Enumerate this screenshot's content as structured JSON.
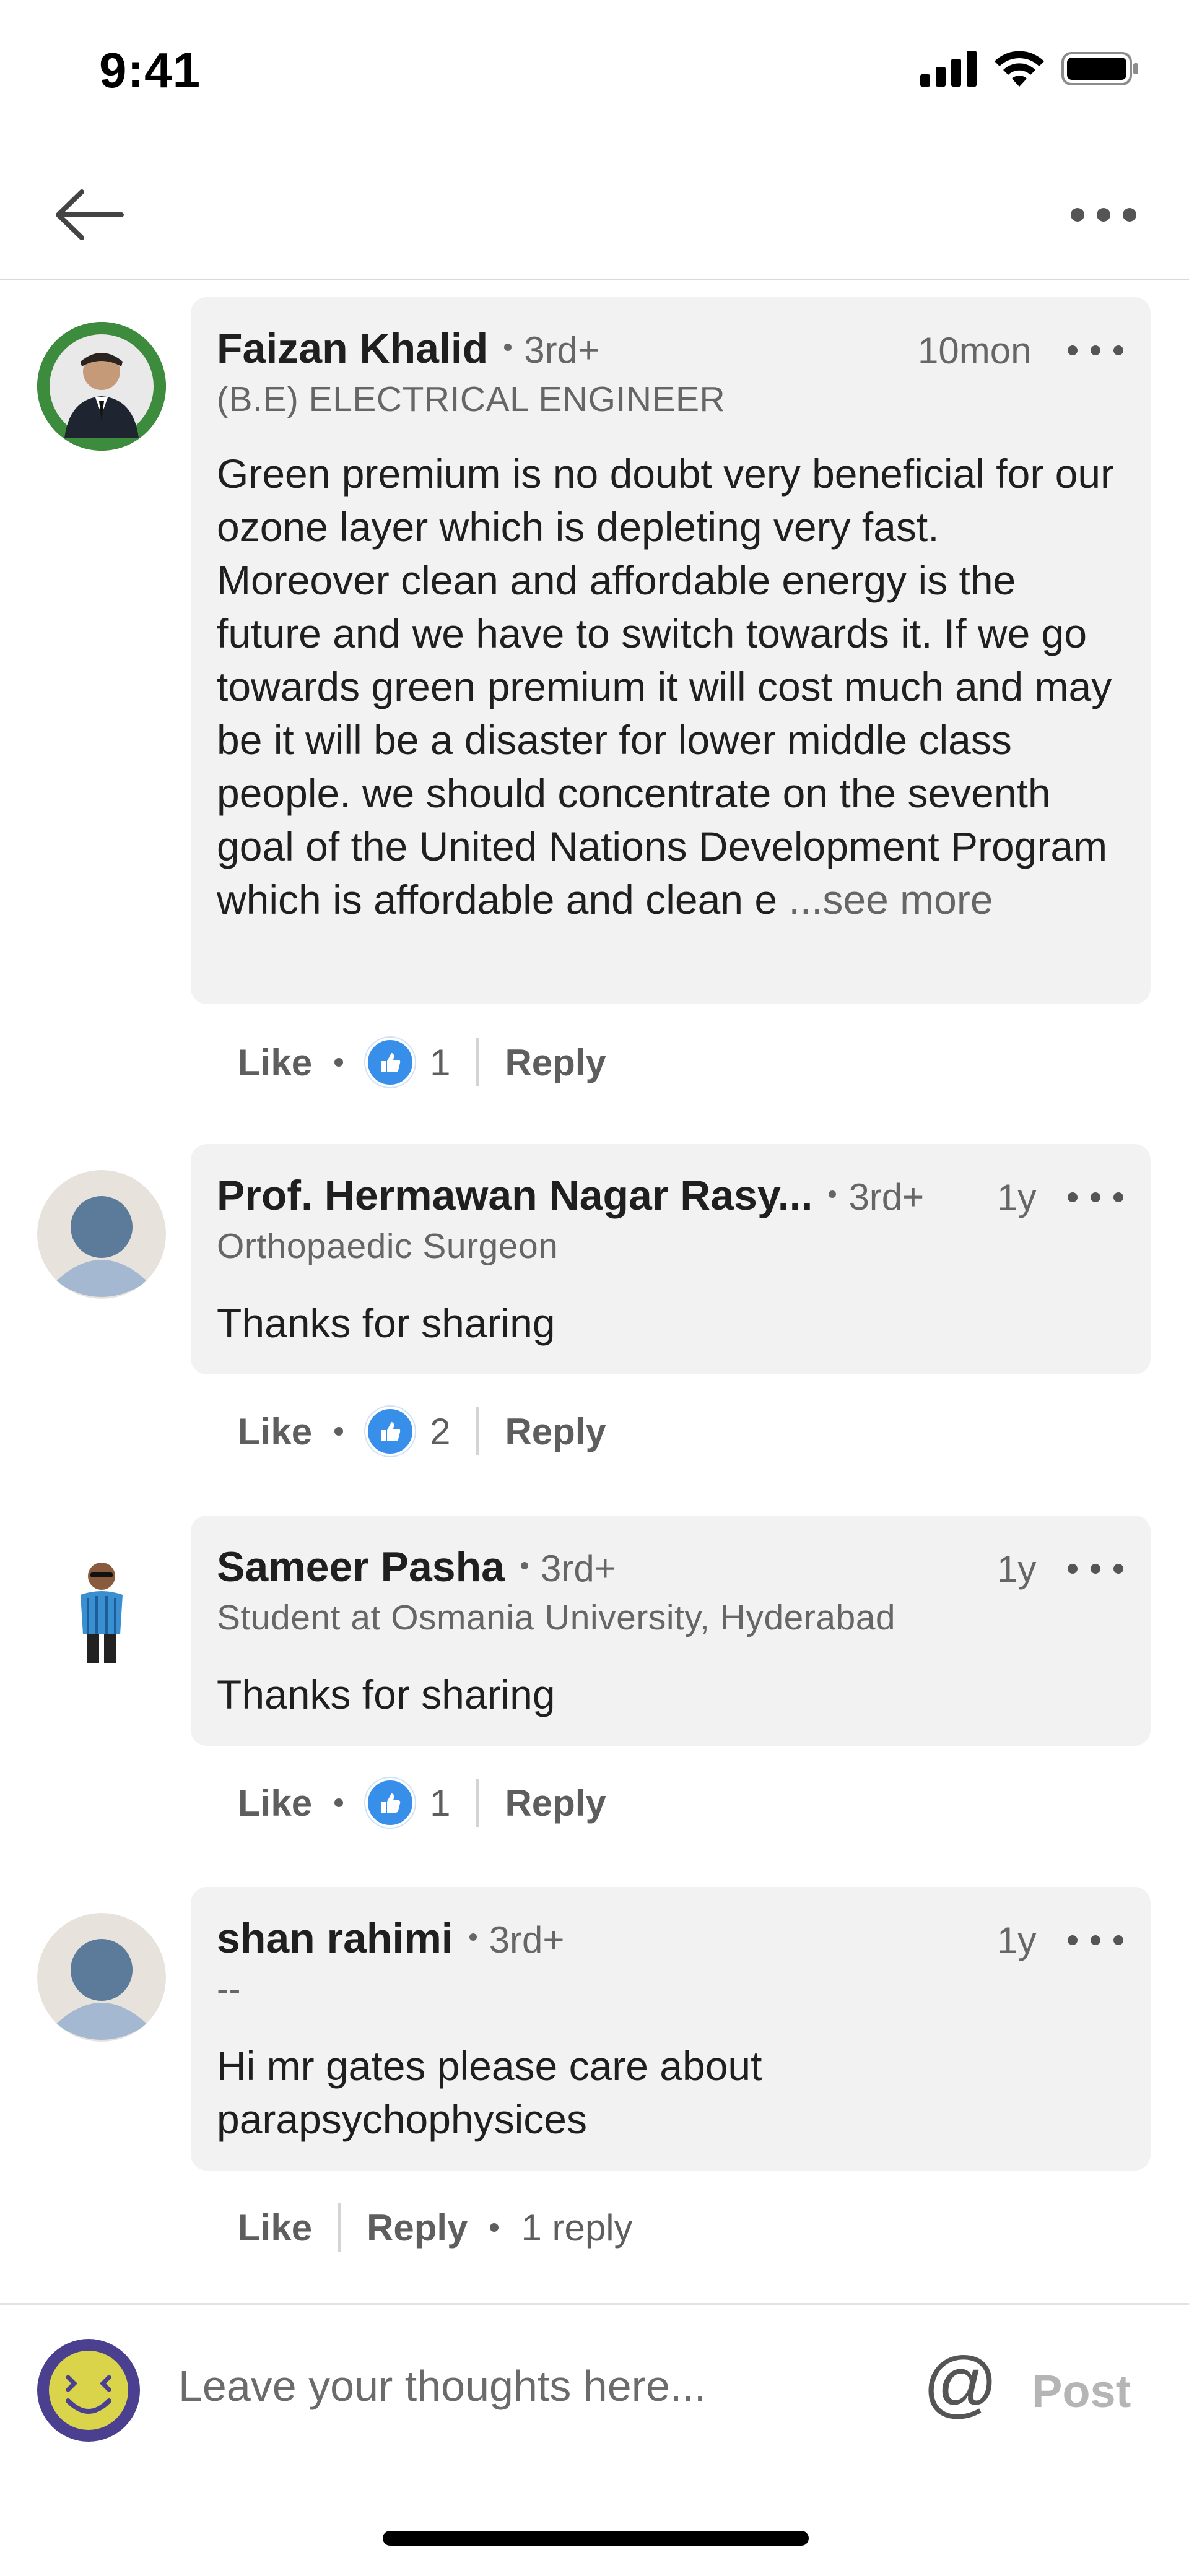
{
  "status_bar": {
    "time": "9:41"
  },
  "nav": {
    "back_icon": "arrow-left-icon",
    "more_icon": "more-horizontal-icon"
  },
  "comments": [
    {
      "name": "Faizan Khalid",
      "degree": "3rd+",
      "time": "10mon",
      "headline": "(B.E) ELECTRICAL ENGINEER",
      "avatar_badge": "#OPENTOWORK",
      "text": "Green premium is no doubt very beneficial for our ozone layer which is depleting very fast. Moreover clean and affordable energy is the future and we have to switch towards it. If we go towards green premium it will cost much and may be it will be a disaster for lower middle class people. we should concentrate on the seventh goal of the United Nations Development Program which is affordable and clean e",
      "see_more": "...see more",
      "like_label": "Like",
      "reactions": "1",
      "reply_label": "Reply"
    },
    {
      "name": "Prof. Hermawan Nagar Rasy...",
      "degree": "3rd+",
      "time": "1y",
      "headline": "Orthopaedic Surgeon",
      "text": "Thanks for sharing",
      "like_label": "Like",
      "reactions": "2",
      "reply_label": "Reply"
    },
    {
      "name": "Sameer Pasha",
      "degree": "3rd+",
      "time": "1y",
      "headline": "Student at Osmania University, Hyderabad",
      "text": "Thanks for sharing",
      "like_label": "Like",
      "reactions": "1",
      "reply_label": "Reply"
    },
    {
      "name": "shan rahimi",
      "degree": "3rd+",
      "time": "1y",
      "headline": "--",
      "text": "Hi mr gates please care about parapsychophysices",
      "like_label": "Like",
      "reply_label": "Reply",
      "reply_count": "1 reply"
    }
  ],
  "composer": {
    "placeholder": "Leave your thoughts here...",
    "at_label": "@",
    "post_label": "Post"
  },
  "colors": {
    "accent": "#378fe9",
    "bubble": "#f2f2f2",
    "muted_text": "#666666"
  }
}
